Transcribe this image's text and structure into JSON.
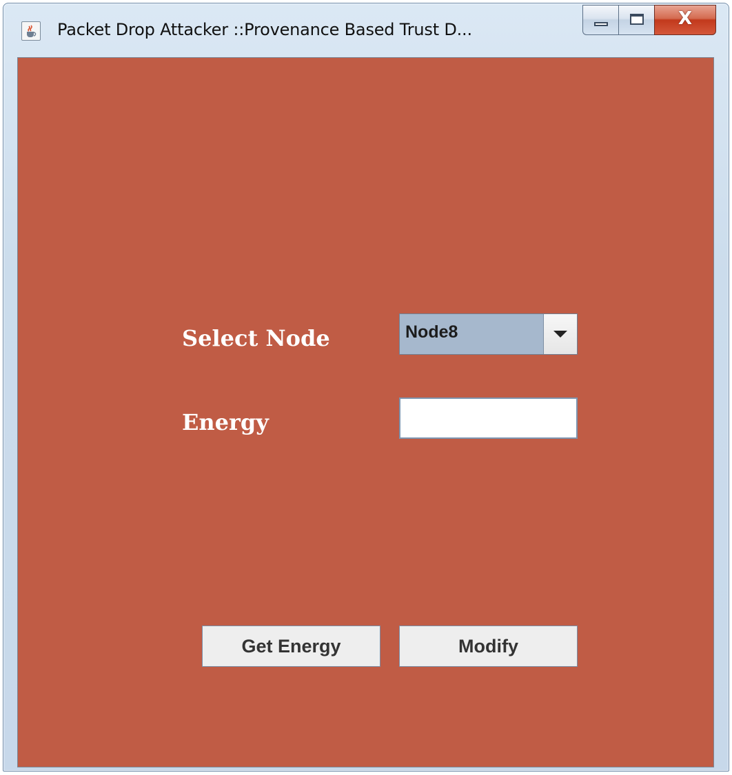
{
  "window": {
    "title": "Packet Drop Attacker ::Provenance Based Trust D...",
    "app_icon": "java-cup-icon",
    "controls": {
      "minimize_icon": "minimize-icon",
      "maximize_icon": "maximize-icon",
      "close_icon": "close-icon",
      "close_glyph": "X"
    }
  },
  "form": {
    "background_color": "#c05c45",
    "select_node_label": "Select Node",
    "node_select": {
      "selected": "Node8"
    },
    "energy_label": "Energy",
    "energy_field": {
      "value": "",
      "placeholder": ""
    },
    "buttons": {
      "get_energy": "Get Energy",
      "modify": "Modify"
    }
  }
}
